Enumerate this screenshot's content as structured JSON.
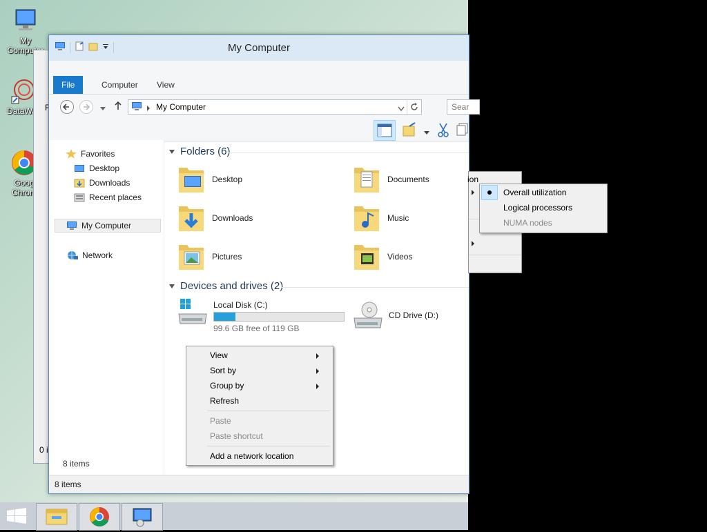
{
  "desktop": {
    "icons": [
      {
        "label": "My Computer"
      },
      {
        "label": "DataWag"
      },
      {
        "label": "Goog"
      },
      {
        "label": "Chrom"
      }
    ]
  },
  "background_window": {
    "status_fragment": "0 i",
    "row_fragment": "F"
  },
  "window": {
    "title": "My Computer",
    "tabs": [
      "File",
      "Computer",
      "View"
    ],
    "address": "My Computer",
    "search_placeholder": "Sear",
    "nav": {
      "favorites": "Favorites",
      "desktop": "Desktop",
      "downloads": "Downloads",
      "recent": "Recent places",
      "my_computer": "My Computer",
      "network": "Network"
    },
    "folders_header": "Folders (6)",
    "folders": [
      "Desktop",
      "Documents",
      "Downloads",
      "Music",
      "Pictures",
      "Videos"
    ],
    "devices_header": "Devices and drives (2)",
    "drives": [
      {
        "name": "Local Disk (C:)",
        "free_text": "99.6 GB free of 119 GB",
        "used_fraction": 0.163
      },
      {
        "name": "CD Drive (D:)"
      }
    ],
    "pane_status": "8 items",
    "status": "8 items"
  },
  "context_menu": {
    "items": [
      "View",
      "Sort by",
      "Group by",
      "Refresh",
      "Paste",
      "Paste shortcut",
      "Add a network location"
    ]
  },
  "submenu_partial": {
    "fragment": "ion"
  },
  "submenu": {
    "items": [
      "Overall utilization",
      "Logical processors",
      "NUMA nodes"
    ]
  },
  "colors": {
    "accent": "#1979ca",
    "title_bar": "#dbe8f5",
    "drive_bar": "#26a0da"
  }
}
